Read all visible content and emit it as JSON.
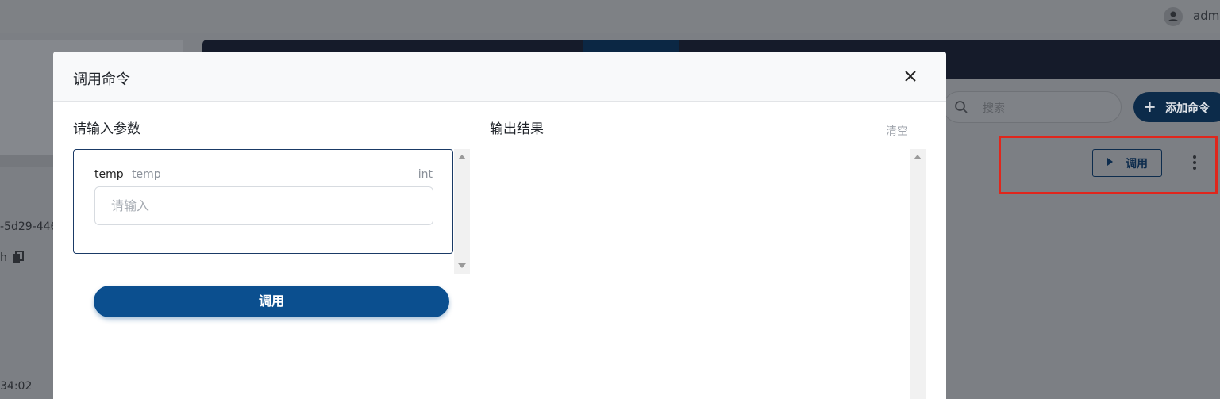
{
  "background": {
    "user_name": "admi",
    "device_id_fragment": "-5d29-446",
    "fragment_h": "h",
    "time_fragment": "34:02",
    "search_placeholder": "搜索",
    "add_command_label": "添加命令",
    "row_invoke_label": "调用"
  },
  "modal": {
    "title": "调用命令",
    "params_label": "请输入参数",
    "param": {
      "name": "temp",
      "description": "temp",
      "type": "int",
      "placeholder": "请输入",
      "value": ""
    },
    "invoke_label": "调用",
    "output_label": "输出结果",
    "clear_label": "清空",
    "output_text": ""
  },
  "colors": {
    "primary": "#0b4f8f",
    "highlight_border": "#e0261c",
    "overlay": "#7c7f84"
  }
}
